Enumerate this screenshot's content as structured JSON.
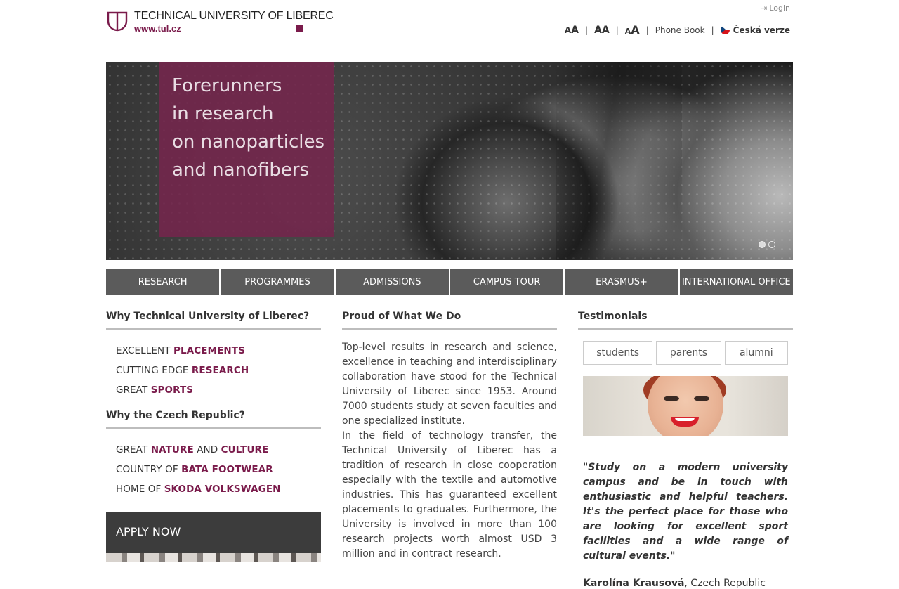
{
  "header": {
    "logo_name": "TECHNICAL UNIVERSITY OF LIBEREC",
    "logo_url": "www.tul.cz",
    "login_label": "Login",
    "font_small": "A",
    "font_normal": "AA",
    "font_large": "AA",
    "phone_book": "Phone Book",
    "language": "Česká verze",
    "separator": "|"
  },
  "hero": {
    "lines": [
      "Forerunners",
      "in research",
      "on nanoparticles",
      "and nanofibers"
    ],
    "slides_total": 2,
    "active_slide": 1
  },
  "nav": {
    "items": [
      "RESEARCH",
      "PROGRAMMES",
      "ADMISSIONS",
      "CAMPUS TOUR",
      "ERASMUS+",
      "INTERNATIONAL OFFICE"
    ]
  },
  "why_tul": {
    "heading": "Why Technical University of Liberec?",
    "items": [
      {
        "pre": "EXCELLENT ",
        "bold": "PLACEMENTS",
        "mid": "",
        "bold2": ""
      },
      {
        "pre": "CUTTING EDGE ",
        "bold": "RESEARCH",
        "mid": "",
        "bold2": ""
      },
      {
        "pre": "GREAT ",
        "bold": "SPORTS",
        "mid": "",
        "bold2": ""
      }
    ]
  },
  "why_czech": {
    "heading": "Why the Czech Republic?",
    "items": [
      {
        "pre": "GREAT ",
        "bold": "NATURE",
        "mid": " AND ",
        "bold2": "CULTURE"
      },
      {
        "pre": "COUNTRY OF ",
        "bold": "BATA FOOTWEAR",
        "mid": "",
        "bold2": ""
      },
      {
        "pre": "HOME OF ",
        "bold": "SKODA VOLKSWAGEN",
        "mid": "",
        "bold2": ""
      }
    ]
  },
  "apply": {
    "label": "APPLY NOW"
  },
  "proud": {
    "heading": "Proud of What We Do",
    "paragraphs": [
      "Top-level results in research and science, excellence in teaching and interdisciplinary collaboration have stood for the Technical University of Liberec since 1953. Around 7000 students study at seven faculties and one specialized institute.",
      "In the field of technology transfer, the Technical University of Liberec has a tradition of research in close cooperation especially with the textile and automotive industries. This has guaranteed excellent placements to graduates. Furthermore, the University is involved in more than 100 research projects worth almost USD 3 million and in contract research."
    ]
  },
  "testimonials": {
    "heading": "Testimonials",
    "tabs": [
      "students",
      "parents",
      "alumni"
    ],
    "quote": "\"Study on a modern university campus and be in touch with enthusiastic and helpful teachers. It's the perfect place for those who are looking for excellent sport facilities and a wide range of cultural events.\"",
    "author_name": "Karolína Krausová",
    "author_country": ", Czech Republic"
  },
  "colors": {
    "brand": "#7a1b4b",
    "nav_bg": "#5b5b5b",
    "apply_bg": "#3c3c3c"
  }
}
